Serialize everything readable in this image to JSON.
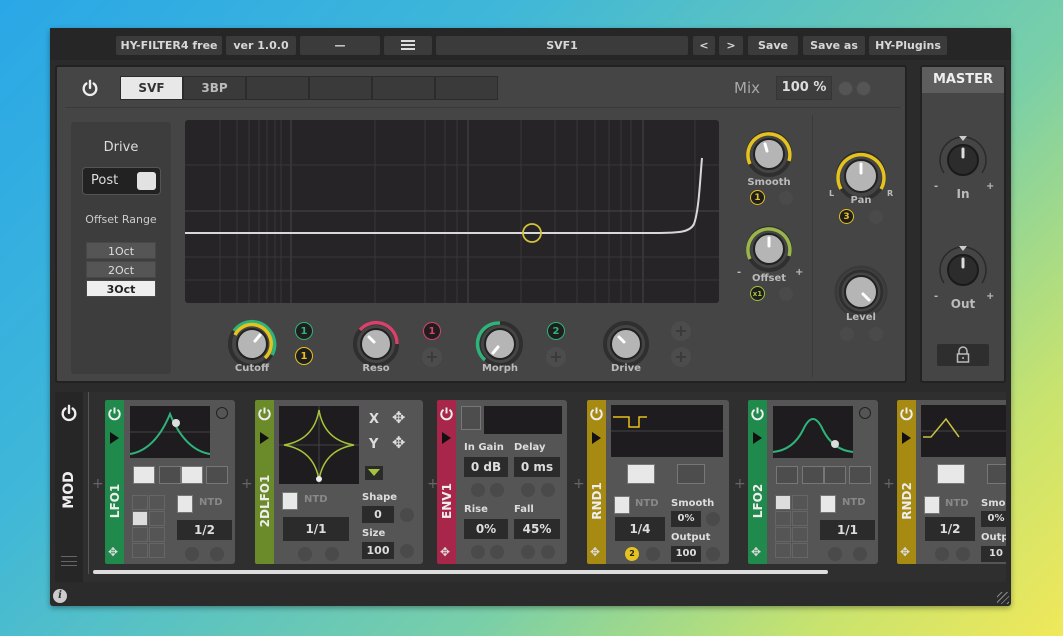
{
  "topbar": {
    "plugin_name": "HY-FILTER4 free",
    "version": "ver 1.0.0",
    "minimize": "—",
    "menu_icon": "hamburger-icon",
    "preset_name": "SVF1",
    "prev": "<",
    "next": ">",
    "save": "Save",
    "save_as": "Save as",
    "brand": "HY-Plugins"
  },
  "filter": {
    "tabs": [
      {
        "label": "SVF",
        "active": true
      },
      {
        "label": "3BP",
        "active": false
      },
      {
        "label": "",
        "active": false
      },
      {
        "label": "",
        "active": false
      },
      {
        "label": "",
        "active": false
      },
      {
        "label": "",
        "active": false
      }
    ],
    "mix_label": "Mix",
    "mix_value": "100 %",
    "drive_label": "Drive",
    "post_label": "Post",
    "offset_range_label": "Offset Range",
    "offset_options": [
      {
        "label": "1Oct",
        "selected": false
      },
      {
        "label": "2Oct",
        "selected": false
      },
      {
        "label": "3Oct",
        "selected": true
      }
    ],
    "knobs": {
      "cutoff": {
        "label": "Cutoff",
        "mods": [
          "1",
          "1"
        ]
      },
      "reso": {
        "label": "Reso",
        "mods": [
          "1"
        ]
      },
      "morph": {
        "label": "Morph",
        "mods": [
          "2"
        ]
      },
      "drive": {
        "label": "Drive",
        "mods": []
      },
      "smooth": {
        "label": "Smooth",
        "mods": [
          "1"
        ]
      },
      "offset": {
        "label": "Offset",
        "mods": [
          "x1"
        ],
        "minus": "-",
        "plus": "+"
      },
      "pan": {
        "label": "Pan",
        "mods": [
          "3"
        ],
        "left": "L",
        "right": "R"
      },
      "level": {
        "label": "Level",
        "mods": []
      }
    }
  },
  "master": {
    "title": "MASTER",
    "in_label": "In",
    "out_label": "Out",
    "minus": "-",
    "plus": "+"
  },
  "mod": {
    "label": "MOD",
    "modules": [
      {
        "name": "LFO1",
        "color": "#1f8a4c",
        "rate": "1/2",
        "ntd": "NTD"
      },
      {
        "name": "2DLFO1",
        "color": "#6b8a2a",
        "rate": "1/1",
        "x_label": "X",
        "y_label": "Y",
        "shape_label": "Shape",
        "shape": "0",
        "size_label": "Size",
        "size": "100",
        "ntd": "NTD"
      },
      {
        "name": "ENV1",
        "color": "#a8264a",
        "in_gain_label": "In Gain",
        "in_gain": "0 dB",
        "delay_label": "Delay",
        "delay": "0 ms",
        "rise_label": "Rise",
        "rise": "0%",
        "fall_label": "Fall",
        "fall": "45%"
      },
      {
        "name": "RND1",
        "color": "#a68a12",
        "rate": "1/4",
        "smooth_label": "Smooth",
        "smooth": "0%",
        "output_label": "Output",
        "output": "100",
        "badge": "2",
        "ntd": "NTD"
      },
      {
        "name": "LFO2",
        "color": "#1f8a4c",
        "rate": "1/1",
        "ntd": "NTD"
      },
      {
        "name": "RND2",
        "color": "#a68a12",
        "rate": "1/2",
        "smooth_label": "Smoo",
        "smooth": "0%",
        "output_label": "Outp",
        "output": "10",
        "ntd": "NTD"
      }
    ]
  },
  "colors": {
    "yellow": "#e6c21e",
    "green": "#2fb37a",
    "pink": "#d8416b",
    "olive": "#a6c43a"
  }
}
